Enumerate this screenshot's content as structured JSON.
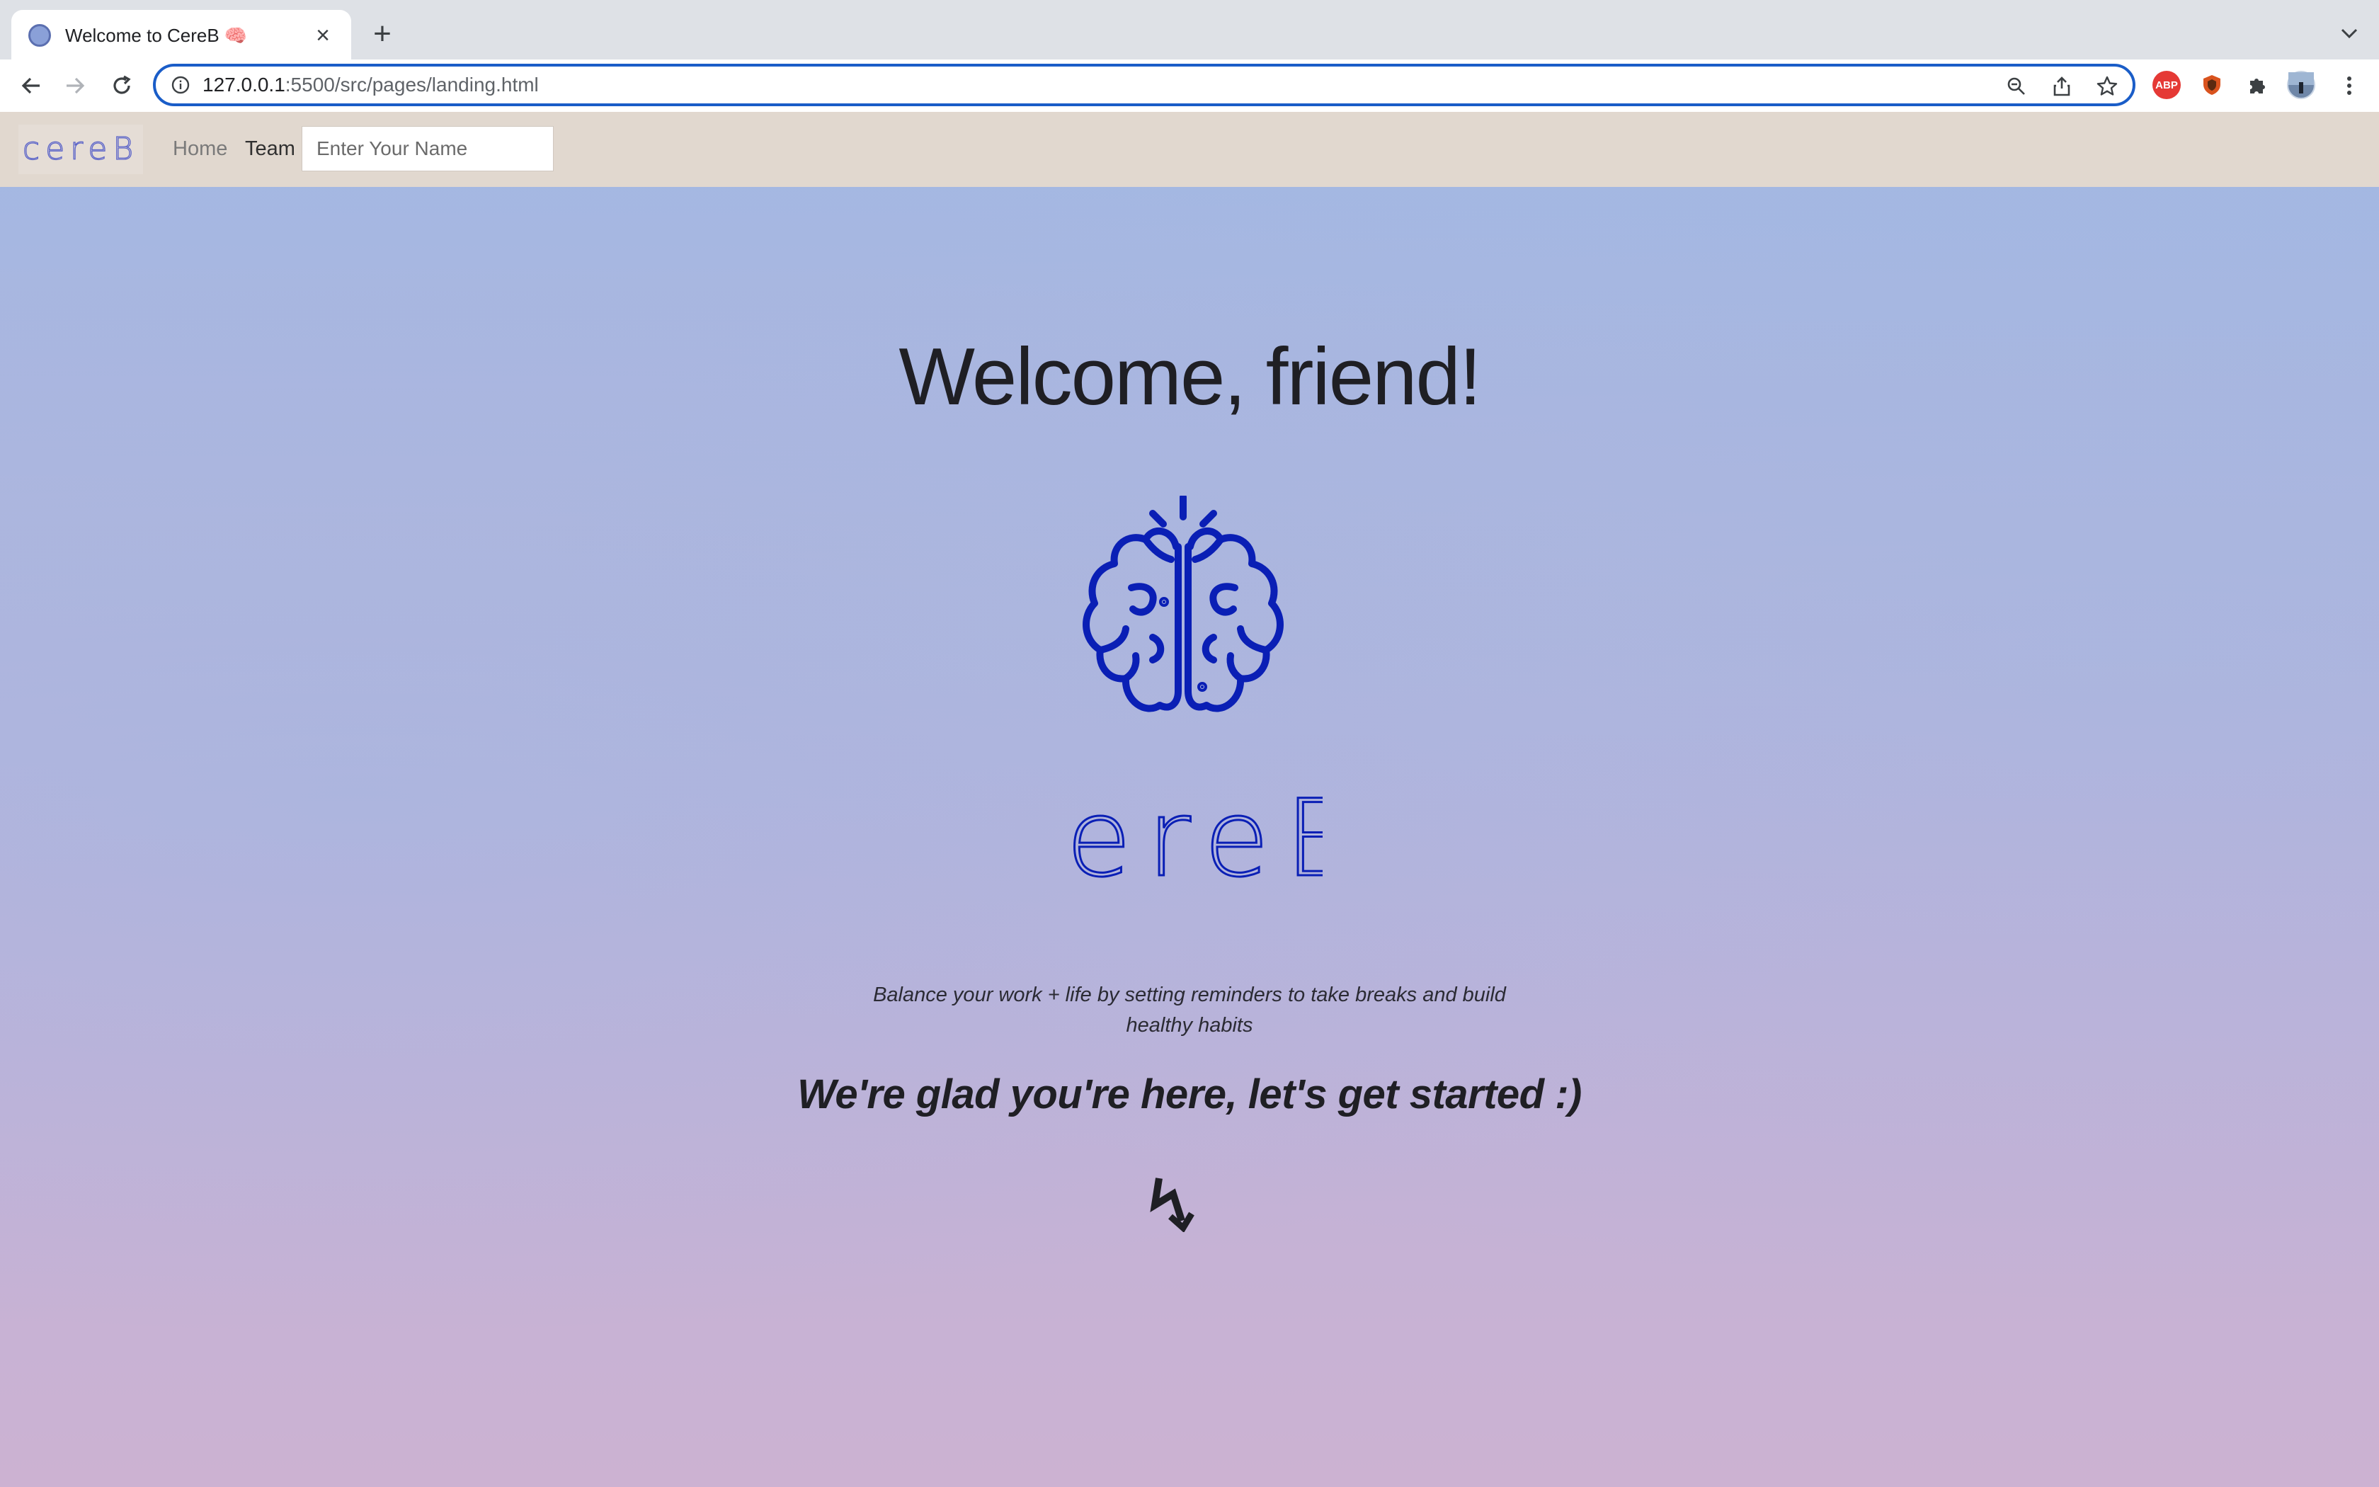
{
  "browser": {
    "tab_title": "Welcome to CereB 🧠",
    "url_host": "127.0.0.1",
    "url_rest": ":5500/src/pages/landing.html",
    "extensions": [
      "adblock-icon",
      "shield-extension-icon",
      "puzzle-icon",
      "profile-avatar"
    ]
  },
  "nav": {
    "brand": "cereB",
    "home_label": "Home",
    "team_label": "Team",
    "name_placeholder": "Enter Your Name"
  },
  "hero": {
    "heading": "Welcome, friend!",
    "logo_text": "cereB",
    "tagline": "Balance your work + life by setting reminders to take breaks and build healthy habits",
    "cta": "We're glad you're here, let's get started :)",
    "arrow_icon": "bolt-arrow-down-icon"
  },
  "colors": {
    "brand_blue": "#0a1fb5",
    "nav_bg": "#e1d8cf",
    "text_dark": "#1f1f24"
  }
}
